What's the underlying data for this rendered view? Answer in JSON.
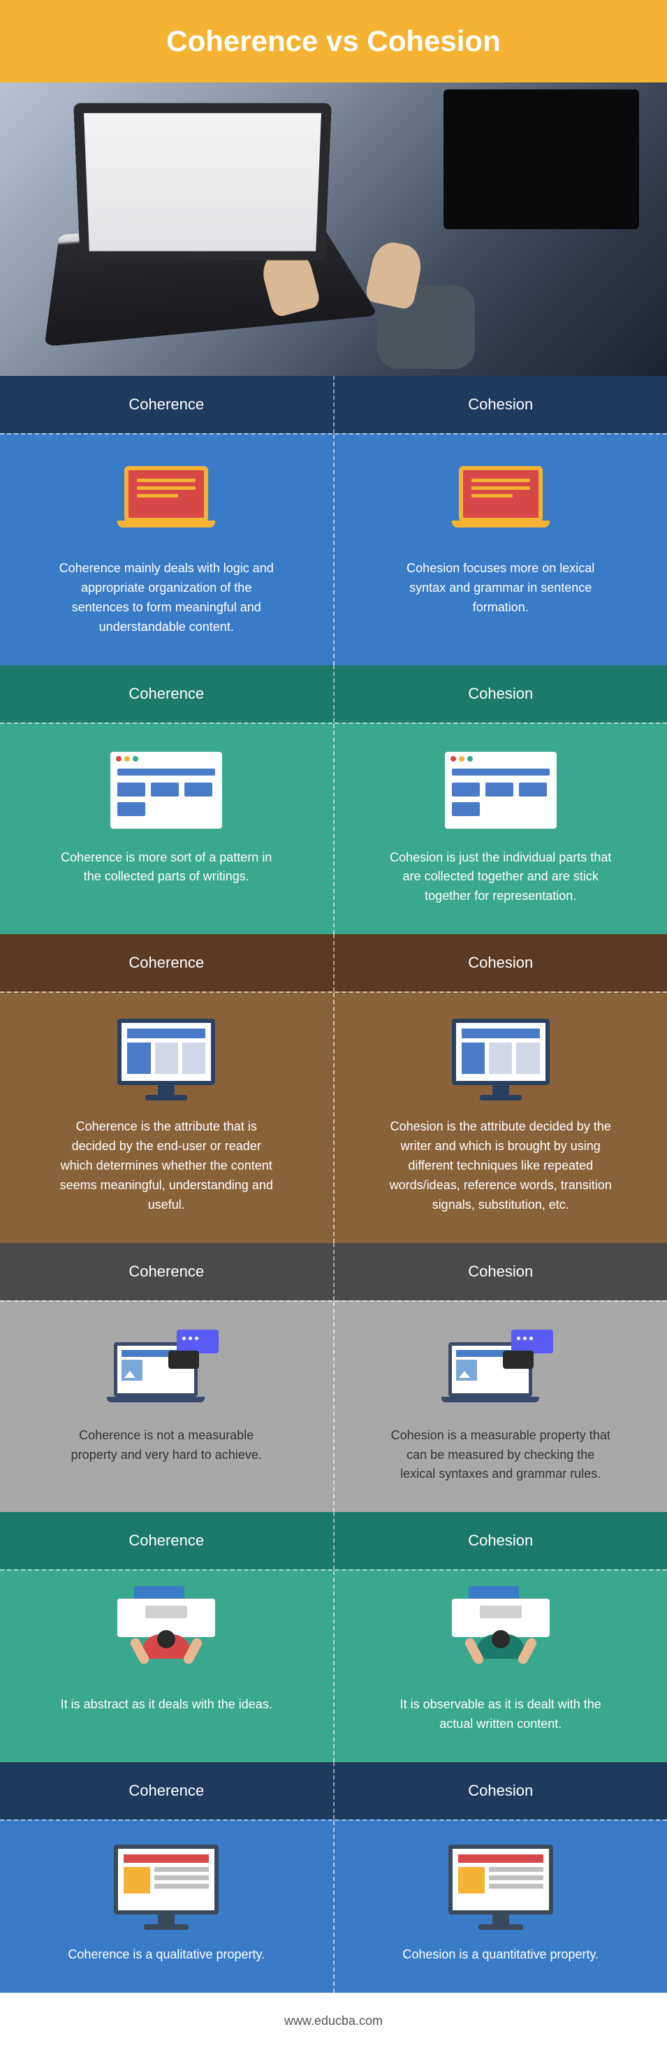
{
  "title": "Coherence vs Cohesion",
  "footer": "www.educba.com",
  "headers": {
    "left": "Coherence",
    "right": "Cohesion"
  },
  "rows": [
    {
      "left": "Coherence mainly deals with logic and appropriate organization of the sentences to form meaningful and understandable content.",
      "right": "Cohesion focuses more on lexical syntax and grammar in sentence formation."
    },
    {
      "left": "Coherence is more sort of a pattern in the collected parts of writings.",
      "right": "Cohesion is just the individual parts that are collected together and are stick together for representation."
    },
    {
      "left": "Coherence is the attribute that is decided by the end-user or reader which determines whether the content seems meaningful, understanding and useful.",
      "right": "Cohesion is the attribute decided by the writer and which is brought by using different techniques like repeated words/ideas, reference words, transition signals, substitution, etc."
    },
    {
      "left": "Coherence is not a measurable property and very hard to achieve.",
      "right": "Cohesion is a measurable property that can be measured by checking the lexical syntaxes and grammar rules."
    },
    {
      "left": "It is abstract as it deals with the ideas.",
      "right": "It is observable as it is dealt with the actual written content."
    },
    {
      "left": "Coherence is a qualitative property.",
      "right": "Cohesion is a quantitative property."
    }
  ]
}
